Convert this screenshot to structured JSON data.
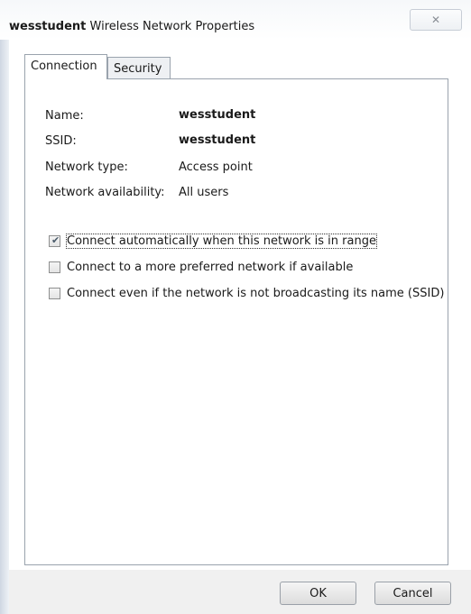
{
  "window": {
    "title_bold": "wesstudent",
    "title_rest": " Wireless Network Properties",
    "close_symbol": "✕"
  },
  "tabs": [
    {
      "label": "Connection",
      "selected": true
    },
    {
      "label": "Security",
      "selected": false
    }
  ],
  "properties": [
    {
      "label": "Name:",
      "value": "wesstudent"
    },
    {
      "label": "SSID:",
      "value": "wesstudent"
    },
    {
      "label": "Network type:",
      "value": "Access point"
    },
    {
      "label": "Network availability:",
      "value": "All users"
    }
  ],
  "options": [
    {
      "label": "Connect automatically when this network is in range",
      "checked": true
    },
    {
      "label": "Connect to a more preferred network if available",
      "checked": false
    },
    {
      "label": "Connect even if the network is not broadcasting its name (SSID)",
      "checked": false
    }
  ],
  "buttons": {
    "ok": "OK",
    "cancel": "Cancel"
  }
}
